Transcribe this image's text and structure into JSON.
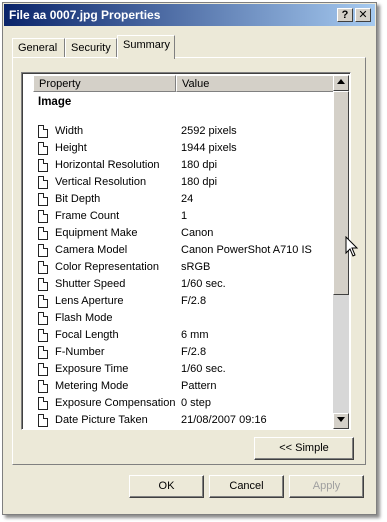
{
  "window": {
    "title": "File aa 0007.jpg Properties",
    "help_label": "?",
    "close_label": "✕"
  },
  "tabs": [
    {
      "label": "General"
    },
    {
      "label": "Security"
    },
    {
      "label": "Summary",
      "active": true
    }
  ],
  "list": {
    "columns": [
      "Property",
      "Value"
    ],
    "group": "Image",
    "rows": [
      {
        "property": "Width",
        "value": "2592 pixels"
      },
      {
        "property": "Height",
        "value": "1944 pixels"
      },
      {
        "property": "Horizontal Resolution",
        "value": "180 dpi"
      },
      {
        "property": "Vertical Resolution",
        "value": "180 dpi"
      },
      {
        "property": "Bit Depth",
        "value": "24"
      },
      {
        "property": "Frame Count",
        "value": "1"
      },
      {
        "property": "Equipment Make",
        "value": "Canon"
      },
      {
        "property": "Camera Model",
        "value": "Canon PowerShot A710 IS"
      },
      {
        "property": "Color Representation",
        "value": "sRGB"
      },
      {
        "property": "Shutter Speed",
        "value": "1/60 sec."
      },
      {
        "property": "Lens Aperture",
        "value": "F/2.8"
      },
      {
        "property": "Flash Mode",
        "value": ""
      },
      {
        "property": "Focal Length",
        "value": "6 mm"
      },
      {
        "property": "F-Number",
        "value": "F/2.8"
      },
      {
        "property": "Exposure Time",
        "value": "1/60 sec."
      },
      {
        "property": "Metering Mode",
        "value": "Pattern"
      },
      {
        "property": "Exposure Compensation",
        "value": "0 step"
      },
      {
        "property": "Date Picture Taken",
        "value": "21/08/2007 09:16"
      }
    ]
  },
  "buttons": {
    "simple": "<< Simple",
    "ok": "OK",
    "cancel": "Cancel",
    "apply": "Apply"
  },
  "icons": {
    "file": "file-icon",
    "scroll_up": "arrow-up-icon",
    "scroll_down": "arrow-down-icon",
    "cursor": "mouse-cursor-icon"
  }
}
